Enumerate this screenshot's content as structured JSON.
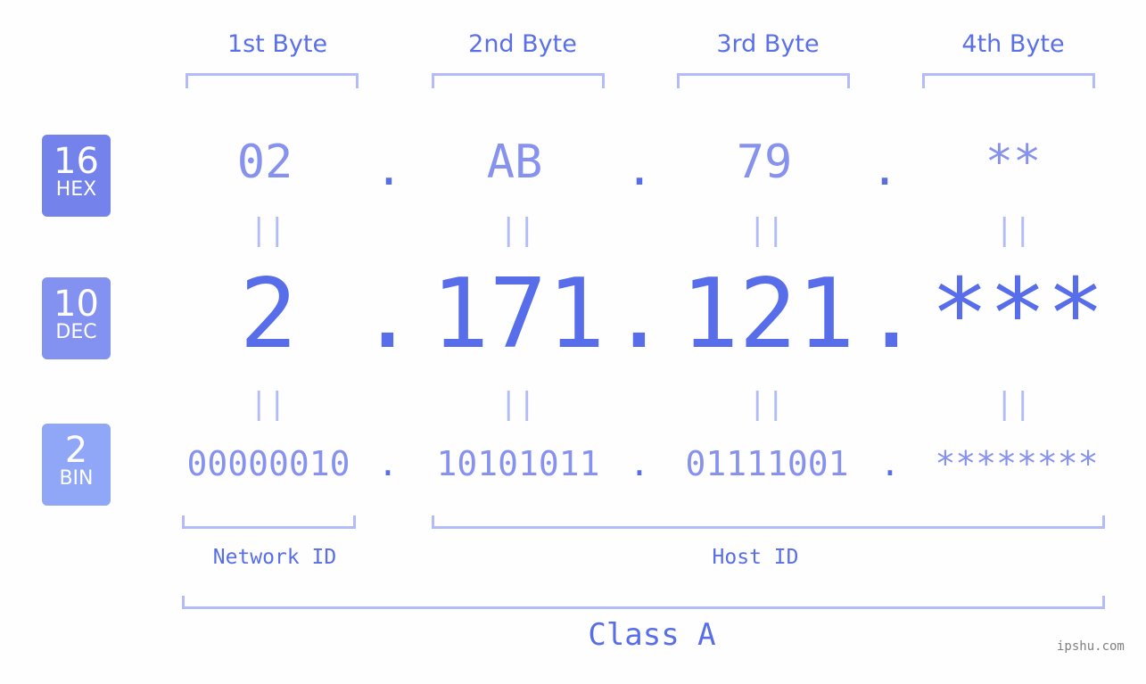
{
  "byte_headers": [
    "1st Byte",
    "2nd Byte",
    "3rd Byte",
    "4th Byte"
  ],
  "badges": [
    {
      "num": "16",
      "label": "HEX",
      "color": "#7482ec"
    },
    {
      "num": "10",
      "label": "DEC",
      "color": "#8391f0"
    },
    {
      "num": "2",
      "label": "BIN",
      "color": "#90a6f7"
    }
  ],
  "hex": [
    "02",
    "AB",
    "79",
    "**"
  ],
  "dec": [
    "2",
    "171",
    "121",
    "***"
  ],
  "bin": [
    "00000010",
    "10101011",
    "01111001",
    "********"
  ],
  "separator": ".",
  "equals": "||",
  "network_id_label": "Network ID",
  "host_id_label": "Host ID",
  "class_label": "Class A",
  "watermark": "ipshu.com"
}
